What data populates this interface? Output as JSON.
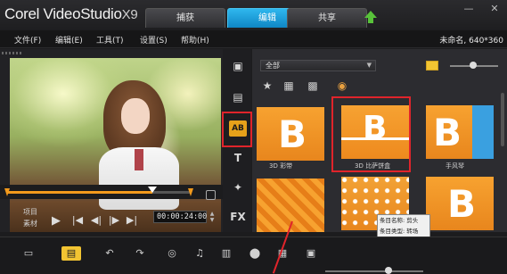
{
  "app": {
    "logo_main": "Corel VideoStudio",
    "logo_version": "X9"
  },
  "tabs": [
    {
      "label": "捕获",
      "active": false
    },
    {
      "label": "编辑",
      "active": true
    },
    {
      "label": "共享",
      "active": false
    }
  ],
  "menu": [
    "文件(F)",
    "编辑(E)",
    "工具(T)",
    "设置(S)",
    "帮助(H)"
  ],
  "project_info": "未命名, 640*360",
  "player": {
    "mode_project": "项目",
    "mode_clip": "素材",
    "timecode": "00:00:24:00",
    "scrub_position": 0.79
  },
  "library": {
    "gallery_selected": "全部",
    "thumbnails": [
      {
        "label": "3D 彩带"
      },
      {
        "label": "3D 比萨饼盒"
      },
      {
        "label": "手风琴"
      },
      {
        "label": ""
      },
      {
        "label": ""
      },
      {
        "label": ""
      }
    ],
    "tooltip_line1": "条目名称: 剪头",
    "tooltip_line2": "条目类型: 转场"
  },
  "colors": {
    "accent_tab": "#1a9fdc",
    "thumbnail_orange": "#f39a1c",
    "annotation_red": "#e0242b",
    "selected_tool": "#e6a21a"
  },
  "icons": [
    "minimize-icon",
    "close-icon",
    "play-icon",
    "transition-icon",
    "title-icon",
    "filter-icon",
    "fx-icon"
  ]
}
